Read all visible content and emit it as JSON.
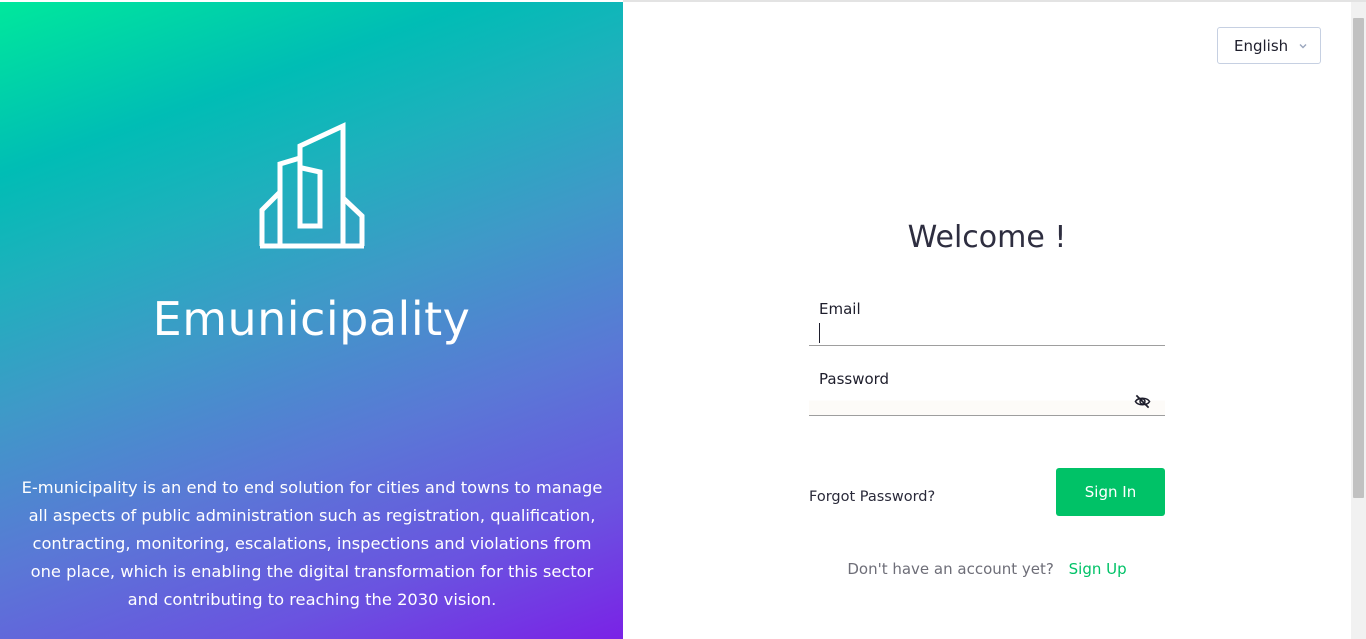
{
  "brand": {
    "logo_icon": "building-icon",
    "name": "Emunicipality",
    "description": "E-municipality is an end to end solution for cities and towns to manage all aspects of public administration such as registration, qualification, contracting, monitoring, escalations, inspections and violations from one place, which is enabling the digital transformation for this sector and contributing to reaching the 2030 vision."
  },
  "language": {
    "selected": "English",
    "icon": "chevron-down-icon"
  },
  "login": {
    "title": "Welcome !",
    "email_label": "Email",
    "email_value": "",
    "password_label": "Password",
    "password_value": "",
    "password_toggle_icon": "eye-off-icon",
    "forgot_password": "Forgot Password?",
    "sign_in": "Sign In",
    "signup_prompt": "Don't have an account yet?",
    "signup_link": "Sign Up"
  },
  "colors": {
    "accent": "#00c267",
    "gradient_top": "#00e89c",
    "gradient_bottom": "#7a22e6",
    "text_dark": "#2e2e40"
  }
}
